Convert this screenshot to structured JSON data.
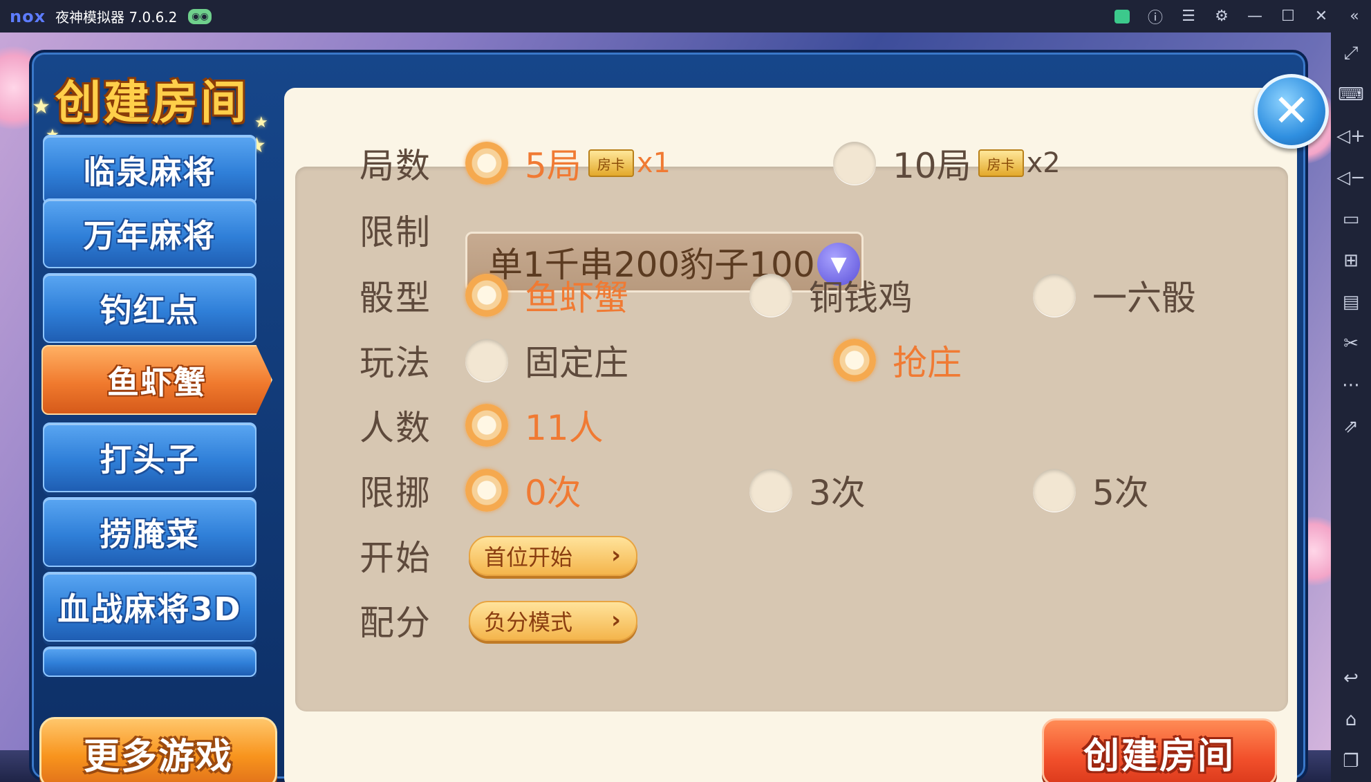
{
  "window": {
    "logo": "nox",
    "title": "夜神模拟器 7.0.6.2",
    "controls": [
      "store-icon",
      "help-icon",
      "menu-icon",
      "settings-icon",
      "minimize-icon",
      "maximize-icon",
      "close-icon",
      "collapse-icon"
    ]
  },
  "sidebar": {
    "tools": [
      "fullscreen-icon",
      "keyboard-icon",
      "volume-up-icon",
      "volume-down-icon",
      "screen-icon",
      "apk-install-icon",
      "multi-instance-icon",
      "screenshot-icon",
      "more-icon",
      "share-icon"
    ],
    "nav": [
      "back-icon",
      "home-icon",
      "recent-apps-icon"
    ]
  },
  "dialog": {
    "title": "创建房间",
    "games": [
      {
        "label": "临泉麻将",
        "active": false
      },
      {
        "label": "万年麻将",
        "active": false
      },
      {
        "label": "钓红点",
        "active": false
      },
      {
        "label": "鱼虾蟹",
        "active": true
      },
      {
        "label": "打头子",
        "active": false
      },
      {
        "label": "捞腌菜",
        "active": false
      },
      {
        "label": "血战麻将3D",
        "active": false
      }
    ],
    "more_games": "更多游戏",
    "create_button": "创建房间"
  },
  "settings": {
    "rounds": {
      "label": "局数",
      "options": [
        {
          "text": "5局",
          "badge": "房卡",
          "mult": "x1",
          "selected": true
        },
        {
          "text": "10局",
          "badge": "房卡",
          "mult": "x2",
          "selected": false
        }
      ]
    },
    "limit": {
      "label": "限制",
      "value": "单1千串200豹子100"
    },
    "dice": {
      "label": "骰型",
      "options": [
        {
          "text": "鱼虾蟹",
          "selected": true
        },
        {
          "text": "铜钱鸡",
          "selected": false
        },
        {
          "text": "一六骰",
          "selected": false
        }
      ]
    },
    "mode": {
      "label": "玩法",
      "options": [
        {
          "text": "固定庄",
          "selected": false
        },
        {
          "text": "抢庄",
          "selected": true
        }
      ]
    },
    "players": {
      "label": "人数",
      "options": [
        {
          "text": "11人",
          "selected": true
        }
      ]
    },
    "move_limit": {
      "label": "限挪",
      "options": [
        {
          "text": "0次",
          "selected": true
        },
        {
          "text": "3次",
          "selected": false
        },
        {
          "text": "5次",
          "selected": false
        }
      ]
    },
    "start": {
      "label": "开始",
      "value": "首位开始"
    },
    "score": {
      "label": "配分",
      "value": "负分模式"
    }
  },
  "colors": {
    "selected_text": "#f07a33",
    "normal_text": "#5e4a3c",
    "active_tab": "#f07a2e",
    "tab": "#2f7fd8",
    "create_button": "#f2502b"
  }
}
